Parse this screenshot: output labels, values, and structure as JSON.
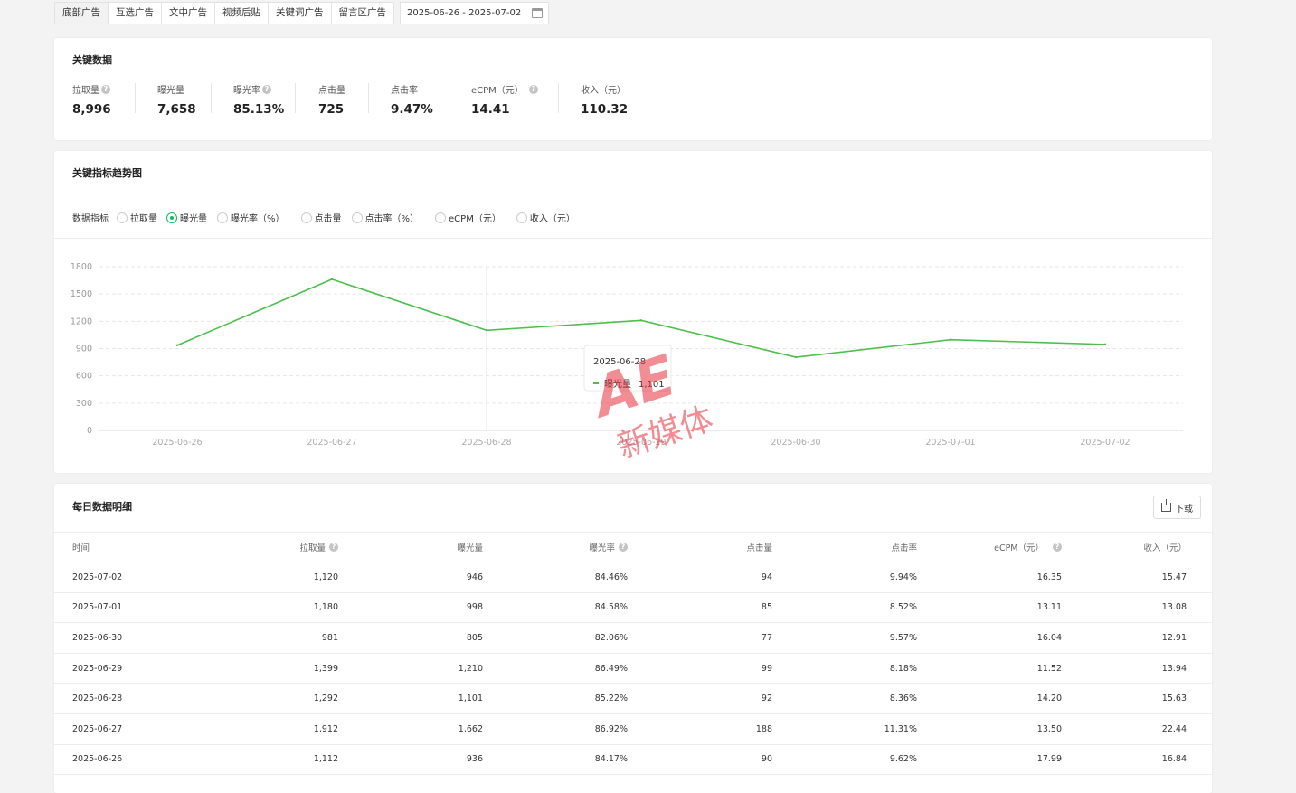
{
  "tabs": [
    "底部广告",
    "互选广告",
    "文中广告",
    "视频后贴",
    "关键词广告",
    "留言区广告"
  ],
  "date_range": "2025-06-26 - 2025-07-02",
  "key_data": {
    "title": "关键数据",
    "metrics": [
      {
        "label": "拉取量",
        "value": "8,996",
        "help": true
      },
      {
        "label": "曝光量",
        "value": "7,658",
        "help": false
      },
      {
        "label": "曝光率",
        "value": "85.13%",
        "help": true
      },
      {
        "label": "点击量",
        "value": "725",
        "help": false
      },
      {
        "label": "点击率",
        "value": "9.47%",
        "help": false
      },
      {
        "label": "eCPM（元）",
        "value": "14.41",
        "help": true
      },
      {
        "label": "收入（元）",
        "value": "110.32",
        "help": false
      }
    ]
  },
  "trend": {
    "title": "关键指标趋势图",
    "indicator_label": "数据指标",
    "options": [
      "拉取量",
      "曝光量",
      "曝光率（%）",
      "点击量",
      "点击率（%）",
      "eCPM（元）",
      "收入（元）"
    ],
    "selected": "曝光量",
    "tooltip": {
      "date": "2025-06-28",
      "series": "曝光量",
      "value": "1,101"
    }
  },
  "chart_data": {
    "type": "line",
    "x": [
      "2025-06-26",
      "2025-06-27",
      "2025-06-28",
      "2025-06-29",
      "2025-06-30",
      "2025-07-01",
      "2025-07-02"
    ],
    "series": [
      {
        "name": "曝光量",
        "values": [
          936,
          1662,
          1101,
          1210,
          805,
          998,
          946
        ],
        "color": "#4cbf4c"
      }
    ],
    "ylim": [
      0,
      1800
    ],
    "yticks": [
      0,
      300,
      600,
      900,
      1200,
      1500,
      1800
    ],
    "grid": true,
    "hover_index": 2
  },
  "daily": {
    "title": "每日数据明细",
    "download_label": "下载",
    "columns": [
      "时间",
      "拉取量",
      "曝光量",
      "曝光率",
      "点击量",
      "点击率",
      "eCPM（元）",
      "收入（元）"
    ],
    "rows": [
      [
        "2025-07-02",
        "1,120",
        "946",
        "84.46%",
        "94",
        "9.94%",
        "16.35",
        "15.47"
      ],
      [
        "2025-07-01",
        "1,180",
        "998",
        "84.58%",
        "85",
        "8.52%",
        "13.11",
        "13.08"
      ],
      [
        "2025-06-30",
        "981",
        "805",
        "82.06%",
        "77",
        "9.57%",
        "16.04",
        "12.91"
      ],
      [
        "2025-06-29",
        "1,399",
        "1,210",
        "86.49%",
        "99",
        "8.18%",
        "11.52",
        "13.94"
      ],
      [
        "2025-06-28",
        "1,292",
        "1,101",
        "85.22%",
        "92",
        "8.36%",
        "14.20",
        "15.63"
      ],
      [
        "2025-06-27",
        "1,912",
        "1,662",
        "86.92%",
        "188",
        "11.31%",
        "13.50",
        "22.44"
      ],
      [
        "2025-06-26",
        "1,112",
        "936",
        "84.17%",
        "90",
        "9.62%",
        "17.99",
        "16.84"
      ]
    ]
  },
  "watermark": {
    "text": "新媒体",
    "color": "#e8323c"
  }
}
